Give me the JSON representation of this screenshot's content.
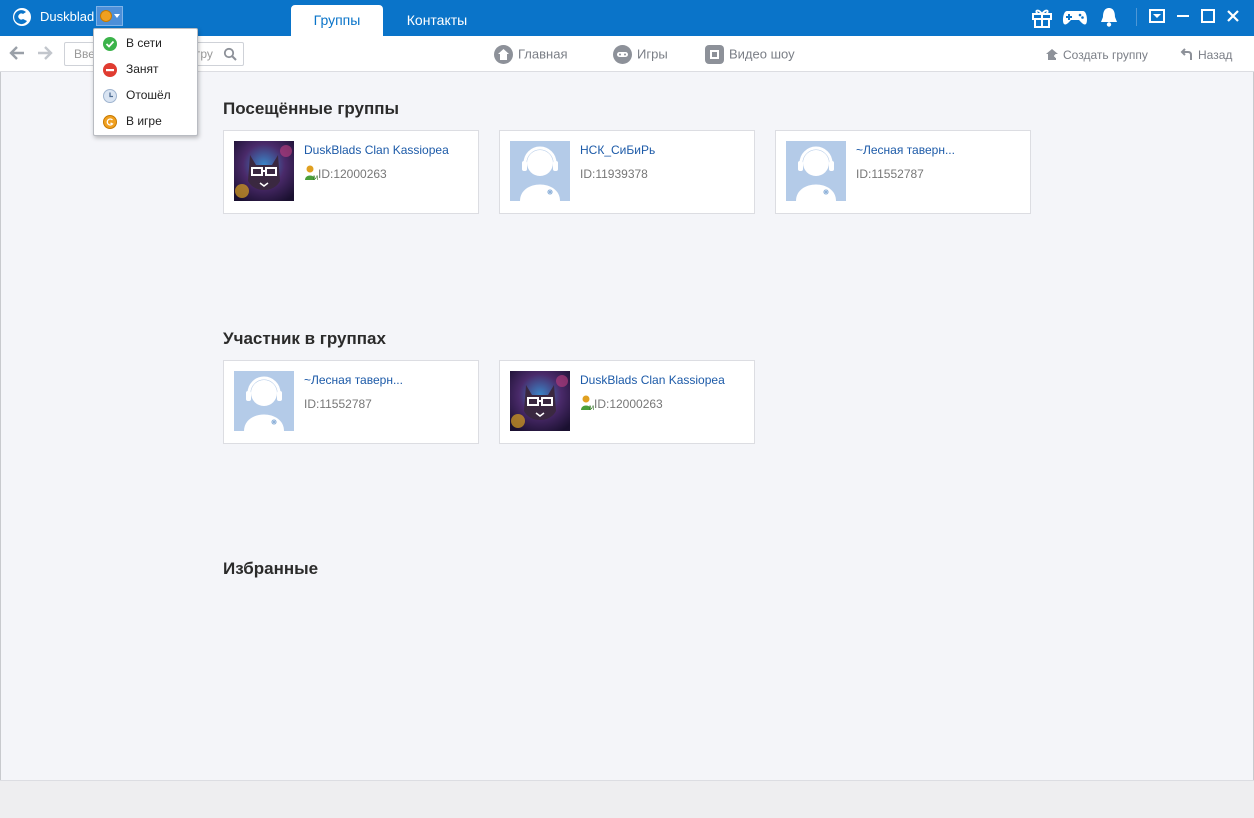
{
  "app": {
    "username": "Duskblad",
    "tabs": [
      {
        "label": "Группы",
        "active": true
      },
      {
        "label": "Контакты",
        "active": false
      }
    ],
    "colors": {
      "accent": "#0a74c9",
      "link": "#1c5aa8"
    }
  },
  "status_menu": {
    "items": [
      {
        "label": "В сети",
        "icon": "online-icon",
        "color": "#3bb34a"
      },
      {
        "label": "Занят",
        "icon": "busy-icon",
        "color": "#e03c31"
      },
      {
        "label": "Отошёл",
        "icon": "away-icon",
        "color": "#d9e4f2"
      },
      {
        "label": "В игре",
        "icon": "in-game-icon",
        "color": "#f0a020"
      }
    ]
  },
  "navbar": {
    "search_placeholder_visible": "Вве",
    "search_placeholder_tail": "гру",
    "links": [
      {
        "label": "Главная",
        "icon": "home-icon"
      },
      {
        "label": "Игры",
        "icon": "gamepad-icon"
      },
      {
        "label": "Видео шоу",
        "icon": "film-icon"
      }
    ],
    "create_group": "Создать группу",
    "back": "Назад"
  },
  "sections": {
    "visited": {
      "title": "Посещённые группы",
      "cards": [
        {
          "name": "DuskBlads Clan Kassiopea",
          "id": "ID:12000263",
          "avatar": "cat-galaxy",
          "badge": true
        },
        {
          "name": "НСК_СиБиРь",
          "id": "ID:11939378",
          "avatar": "default",
          "badge": false
        },
        {
          "name": "~Лесная таверн...",
          "id": "ID:11552787",
          "avatar": "default",
          "badge": false
        }
      ]
    },
    "member": {
      "title": "Участник в группах",
      "cards": [
        {
          "name": "~Лесная таверн...",
          "id": "ID:11552787",
          "avatar": "default",
          "badge": false
        },
        {
          "name": "DuskBlads Clan Kassiopea",
          "id": "ID:12000263",
          "avatar": "cat-galaxy",
          "badge": true
        }
      ]
    },
    "favorites": {
      "title": "Избранные"
    }
  }
}
